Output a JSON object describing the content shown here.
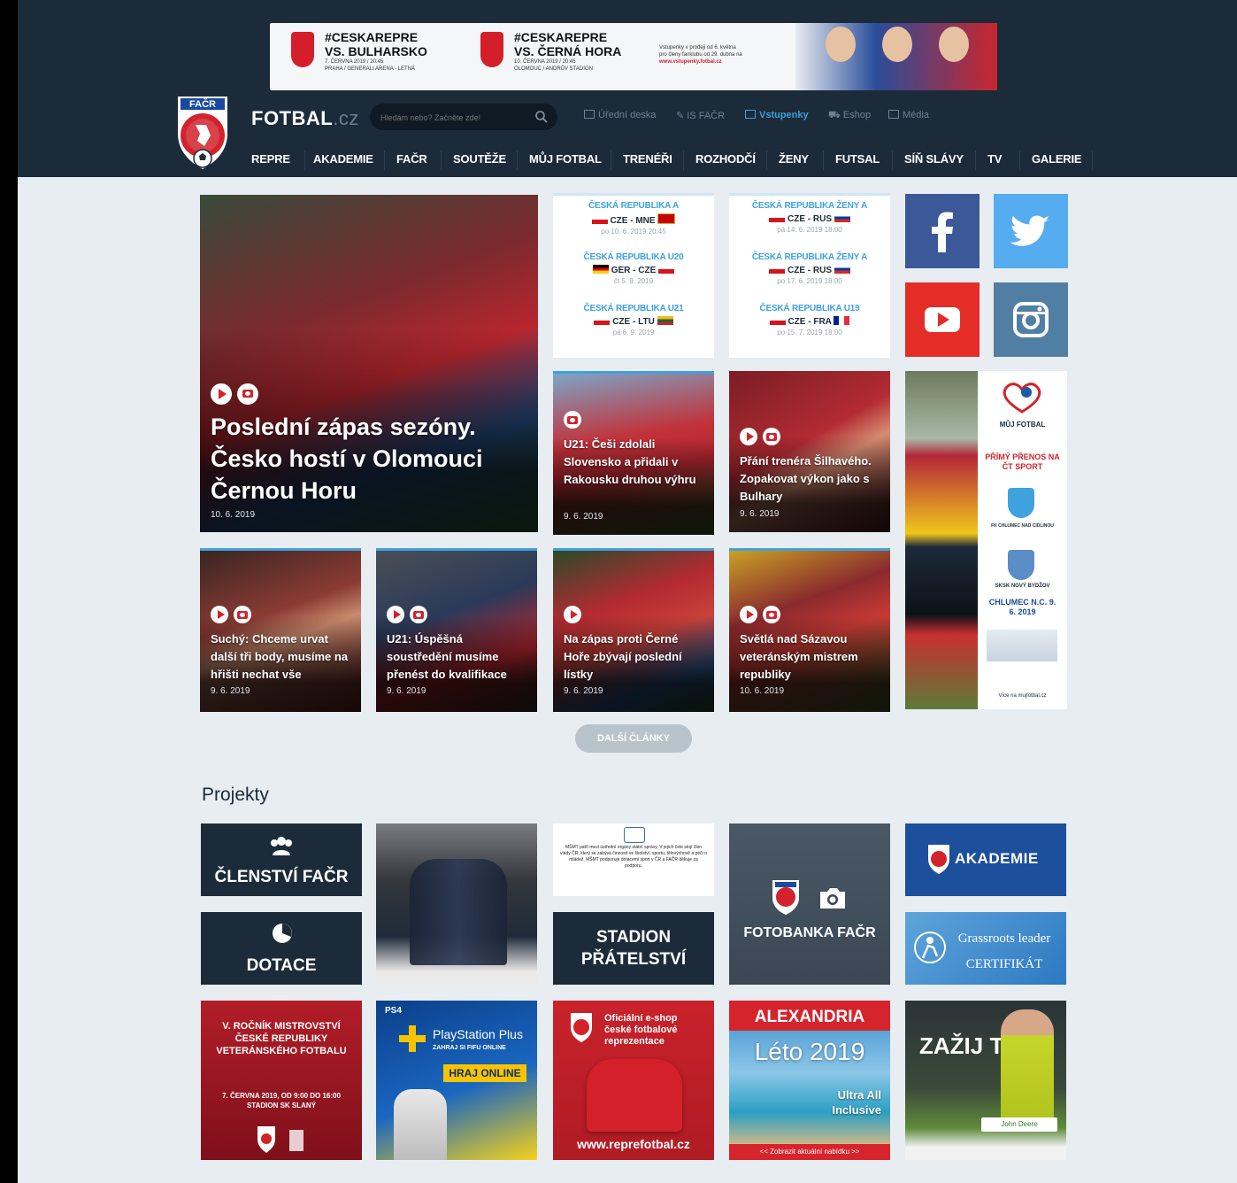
{
  "banner": {
    "matches": [
      {
        "hashtag": "#CESKAREPRE",
        "vs": "VS. BULHARSKO",
        "details": "7. ČERVNA 2019 / 20:45",
        "venue": "PRAHA / GENERALI ARENA - LETNÁ"
      },
      {
        "hashtag": "#CESKAREPRE",
        "vs": "VS. ČERNÁ HORA",
        "details": "10. ČERVNA 2019 / 20:45",
        "venue": "OLOMOUC / ANDRŮV STADION"
      }
    ],
    "tickets_text": "Vstupenky v prodeji od 6. května",
    "tickets_sub": "pro členy fanklubu od 29. dubna na",
    "tickets_url": "www.vstupenky.fotbal.cz"
  },
  "header": {
    "site_name": "FOTBAL",
    "site_tld": ".cz",
    "search_placeholder": "Hledám nebo? Začněte zde!",
    "utility": [
      "Úřední deska",
      "IS FAČR",
      "Vstupenky",
      "Eshop",
      "Média"
    ],
    "nav": [
      "REPRE",
      "AKADEMIE",
      "FAČR",
      "SOUTĚŽE",
      "MŮJ FOTBAL",
      "TRENÉŘI",
      "ROZHODČÍ",
      "ŽENY",
      "FUTSAL",
      "SÍŇ SLÁVY",
      "TV",
      "GALERIE"
    ]
  },
  "featured": {
    "title": "Poslední zápas sezóny. Česko hostí v Olomouci Černou Horu",
    "date": "10. 6. 2019"
  },
  "fixtures_left": [
    {
      "category": "ČESKÁ REPUBLIKA A",
      "match": "CZE - MNE",
      "when": "po 10. 6. 2019 20:45"
    },
    {
      "category": "ČESKÁ REPUBLIKA U20",
      "match": "GER - CZE",
      "when": "čt 5. 9. 2019"
    },
    {
      "category": "ČESKÁ REPUBLIKA U21",
      "match": "CZE - LTU",
      "when": "pá 6. 9. 2019"
    }
  ],
  "fixtures_right": [
    {
      "category": "ČESKÁ REPUBLIKA ŽENY A",
      "match": "CZE - RUS",
      "when": "pá 14. 6. 2019 18:00"
    },
    {
      "category": "ČESKÁ REPUBLIKA ŽENY A",
      "match": "CZE - RUS",
      "when": "po 17. 6. 2019 18:00"
    },
    {
      "category": "ČESKÁ REPUBLIKA U19",
      "match": "CZE - FRA",
      "when": "po 15. 7. 2019 18:00"
    }
  ],
  "news": [
    {
      "title": "U21: Češi zdolali Slovensko a přidali v Rakousku druhou výhru",
      "date": "9. 6. 2019"
    },
    {
      "title": "Přání trenéra Šilhavého. Zopakovat výkon jako s Bulhary",
      "date": "9. 6. 2019"
    },
    {
      "title": "Suchý: Chceme urvat další tři body, musíme na hřišti nechat vše",
      "date": "9. 6. 2019"
    },
    {
      "title": "U21: Úspěšná soustředění musíme přenést do kvalifikace",
      "date": "9. 6. 2019"
    },
    {
      "title": "Na zápas proti Černé Hoře zbývají poslední lístky",
      "date": "9. 6. 2019"
    },
    {
      "title": "Světlá nad Sázavou veteránským mistrem republiky",
      "date": "10. 6. 2019"
    }
  ],
  "side_ad": {
    "brand": "MŮJ FOTBAL",
    "headline": "PŘÍMÝ PŘENOS NA ČT SPORT",
    "team1": "FK CHLUMEC NAD CIDLINOU",
    "team2": "SKSK NOVÝ BYDŽOV",
    "place_date": "CHLUMEC N.C. 9. 6. 2019",
    "footer": "Více na mujfotbal.cz"
  },
  "more_button": "DALŠÍ ČLÁNKY",
  "projects_title": "Projekty",
  "projects": {
    "membership": "ČLENSTVÍ FAČR",
    "dotace": "DOTACE",
    "msmt_text": "MŠMT patří mezi ústřední orgány státní správy. V jejich čele stojí člen vlády ČR, který se zabývá činností ve školství, sportu, tělovýchově a péči o mládež. MŠMT podporuje dotacemi sport v ČR a FAČR děkuje za podporu.",
    "stadion": "STADION PŘÁTELSTVÍ",
    "fotobanka": "FOTOBANKA FAČR",
    "akademie": "AKADEMIE",
    "grassroots": "Grassroots leader CERTIFIKÁT",
    "veterans": "V. ROČNÍK MISTROVSTVÍ ČESKÉ REPUBLIKY VETERÁNSKÉHO FOTBALU",
    "veterans_date": "7. ČERVNA 2019, OD 9:00 DO 16:00 STADION SK SLANÝ",
    "ps_brand": "PlayStation Plus",
    "ps_sub": "ZAHRAJ SI FIFU ONLINE",
    "ps_cta": "HRAJ ONLINE",
    "eshop_title": "Oficiální e-shop české fotbalové reprezentace",
    "eshop_url": "www.reprefotbal.cz",
    "alexandria": "ALEXANDRIA",
    "alexandria_title": "Léto 2019",
    "alexandria_tag": "Ultra All Inclusive",
    "alexandria_link": "<< Zobrazit aktuální nabídku >>",
    "deere_title": "ZAŽIJ TO",
    "deere_brand": "John Deere"
  },
  "colors": {
    "header": "#1c2b3a",
    "accent": "#3c9ddc",
    "red": "#d2232c",
    "facebook": "#3b5998",
    "twitter": "#55acee",
    "youtube": "#e52d27",
    "instagram": "#517fa4"
  }
}
